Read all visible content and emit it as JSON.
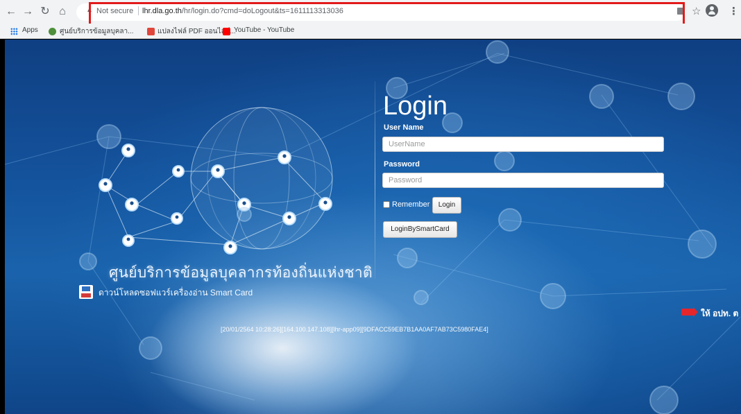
{
  "browser": {
    "security_label": "Not secure",
    "url_host": "lhr.dla.go.th",
    "url_path": "/hr/login.do?cmd=doLogout&ts=1611113313036"
  },
  "bookmarks": {
    "apps_label": "Apps",
    "items": [
      "ศูนย์บริการข้อมูลบุคลา...",
      "แปลงไฟล์ PDF ออนไลน์...",
      "YouTube - YouTube"
    ]
  },
  "brand": {
    "center_name": "ศูนย์บริการข้อมูลบุคลากรท้องถิ่นแห่งชาติ",
    "download_link": "ดาวน์โหลดซอฟแวร์เครื่องอ่าน Smart Card"
  },
  "login": {
    "title": "Login",
    "username_label": "User Name",
    "username_placeholder": "UserName",
    "password_label": "Password",
    "password_placeholder": "Password",
    "remember_label": "Remember",
    "login_button": "Login",
    "smartcard_button": "LoginBySmartCard"
  },
  "footer": {
    "session_info": "[20/01/2564 10:28:26][164.100.147.108][lhr-app09][9DFACC59EB7B1AA0AF7AB73C5980FAE4]"
  },
  "news": {
    "ticker_text": "ให้ อปท. ต"
  },
  "colors": {
    "highlight": "#e21a1a",
    "page_bg": "#14539d"
  }
}
